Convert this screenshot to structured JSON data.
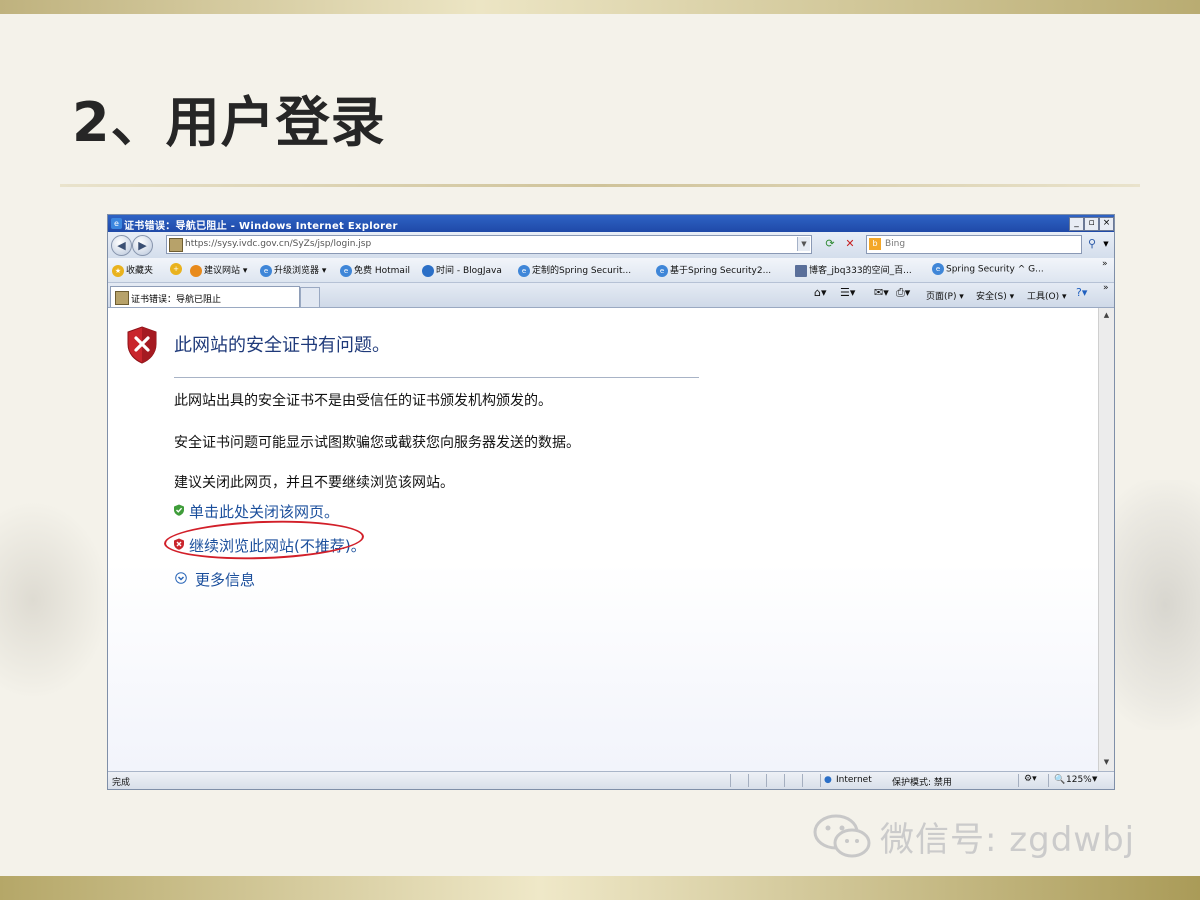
{
  "slide": {
    "title": "2、用户登录",
    "watermark": "微信号: zgdwbj"
  },
  "ie": {
    "window_title": "证书错误：导航已阻止 - Windows Internet Explorer",
    "url": "https://sysy.ivdc.gov.cn/SyZs/jsp/login.jsp",
    "search_placeholder": "Bing",
    "favorites_label": "收藏夹",
    "favorites": [
      "建议网站 ▾",
      "升级浏览器 ▾",
      "免费 Hotmail",
      "时间 - BlogJava",
      "定制的Spring Securit...",
      "基于Spring Security2...",
      "博客_jbq333的空间_百...",
      "Spring Security ^ G..."
    ],
    "tab_title": "证书错误：导航已阻止",
    "commands": {
      "page": "页面(P) ▾",
      "safety": "安全(S) ▾",
      "tools": "工具(O) ▾"
    },
    "status": {
      "left": "完成",
      "zone": "Internet",
      "protected_mode": "保护模式: 禁用",
      "zoom": "125%"
    }
  },
  "cert_error": {
    "heading": "此网站的安全证书有问题。",
    "para1": "此网站出具的安全证书不是由受信任的证书颁发机构颁发的。",
    "para2": "安全证书问题可能显示试图欺骗您或截获您向服务器发送的数据。",
    "para3": "建议关闭此网页，并且不要继续浏览该网站。",
    "link_close": "单击此处关闭该网页。",
    "link_continue": "继续浏览此网站(不推荐)。",
    "link_more": "更多信息"
  },
  "colors": {
    "title_bar": "#1f49a8",
    "link": "#1b4f9c",
    "heading": "#1f3a7a",
    "annotation_circle": "#d21f29"
  }
}
